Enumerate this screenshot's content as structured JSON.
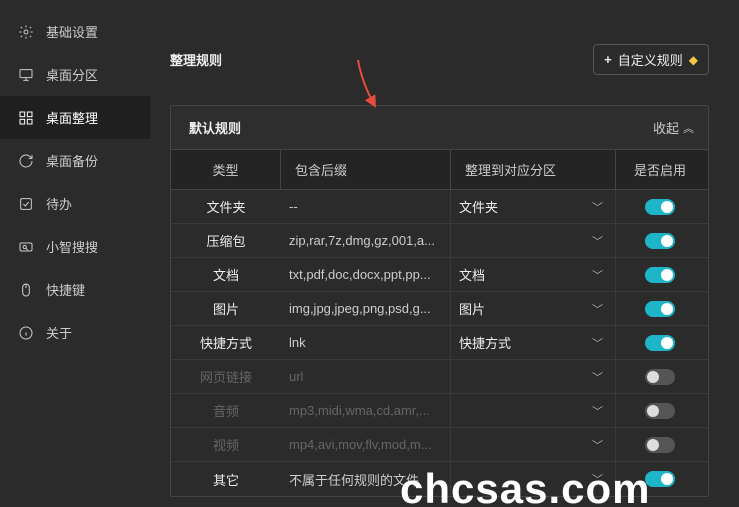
{
  "sidebar": {
    "items": [
      {
        "label": "基础设置",
        "icon": "gear"
      },
      {
        "label": "桌面分区",
        "icon": "monitor"
      },
      {
        "label": "桌面整理",
        "icon": "grid",
        "active": true
      },
      {
        "label": "桌面备份",
        "icon": "refresh"
      },
      {
        "label": "待办",
        "icon": "checkbox"
      },
      {
        "label": "小智搜搜",
        "icon": "search-box"
      },
      {
        "label": "快捷键",
        "icon": "mouse"
      },
      {
        "label": "关于",
        "icon": "info"
      }
    ]
  },
  "section": {
    "title": "整理规则",
    "custom_btn": "自定义规则"
  },
  "table": {
    "title": "默认规则",
    "collapse_label": "收起",
    "headers": {
      "type": "类型",
      "ext": "包含后缀",
      "dest": "整理到对应分区",
      "enable": "是否启用"
    },
    "rows": [
      {
        "type": "文件夹",
        "ext": "--",
        "dest": "文件夹",
        "enabled": true
      },
      {
        "type": "压缩包",
        "ext": "zip,rar,7z,dmg,gz,001,a...",
        "dest": "",
        "enabled": true
      },
      {
        "type": "文档",
        "ext": "txt,pdf,doc,docx,ppt,pp...",
        "dest": "文档",
        "enabled": true
      },
      {
        "type": "图片",
        "ext": "img,jpg,jpeg,png,psd,g...",
        "dest": "图片",
        "enabled": true
      },
      {
        "type": "快捷方式",
        "ext": "lnk",
        "dest": "快捷方式",
        "enabled": true
      },
      {
        "type": "网页链接",
        "ext": "url",
        "dest": "",
        "enabled": false
      },
      {
        "type": "音频",
        "ext": "mp3,midi,wma,cd,amr,...",
        "dest": "",
        "enabled": false
      },
      {
        "type": "视频",
        "ext": "mp4,avi,mov,flv,mod,m...",
        "dest": "",
        "enabled": false
      },
      {
        "type": "其它",
        "ext": "不属于任何规则的文件",
        "dest": "",
        "enabled": true
      }
    ]
  },
  "watermark": "chcsas.com"
}
